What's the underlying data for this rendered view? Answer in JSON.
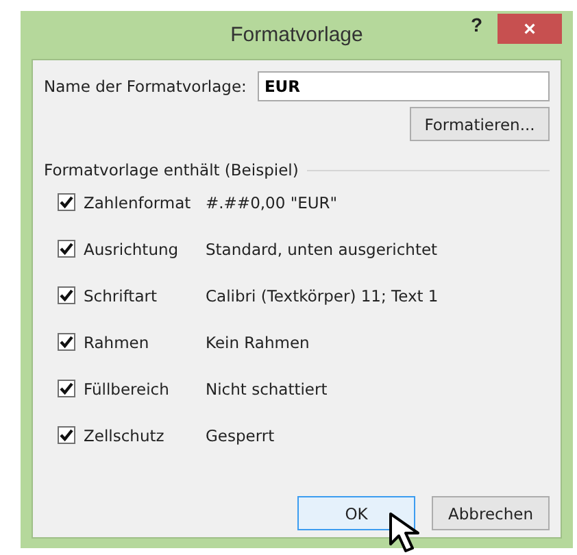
{
  "window": {
    "title": "Formatvorlage",
    "help": "?",
    "close": "×"
  },
  "name_field": {
    "label": "Name der Formatvorlage:",
    "value": "EUR"
  },
  "format_button": "Formatieren...",
  "group": {
    "title": "Formatvorlage enthält (Beispiel)",
    "items": [
      {
        "label": "Zahlenformat",
        "value": "#.##0,00 \"EUR\"",
        "checked": true
      },
      {
        "label": "Ausrichtung",
        "value": "Standard, unten ausgerichtet",
        "checked": true
      },
      {
        "label": "Schriftart",
        "value": "Calibri (Textkörper) 11; Text 1",
        "checked": true
      },
      {
        "label": "Rahmen",
        "value": "Kein Rahmen",
        "checked": true
      },
      {
        "label": "Füllbereich",
        "value": "Nicht schattiert",
        "checked": true
      },
      {
        "label": "Zellschutz",
        "value": "Gesperrt",
        "checked": true
      }
    ]
  },
  "buttons": [
    {
      "label": "OK",
      "selected": true
    },
    {
      "label": "Abbrechen",
      "selected": false
    }
  ]
}
